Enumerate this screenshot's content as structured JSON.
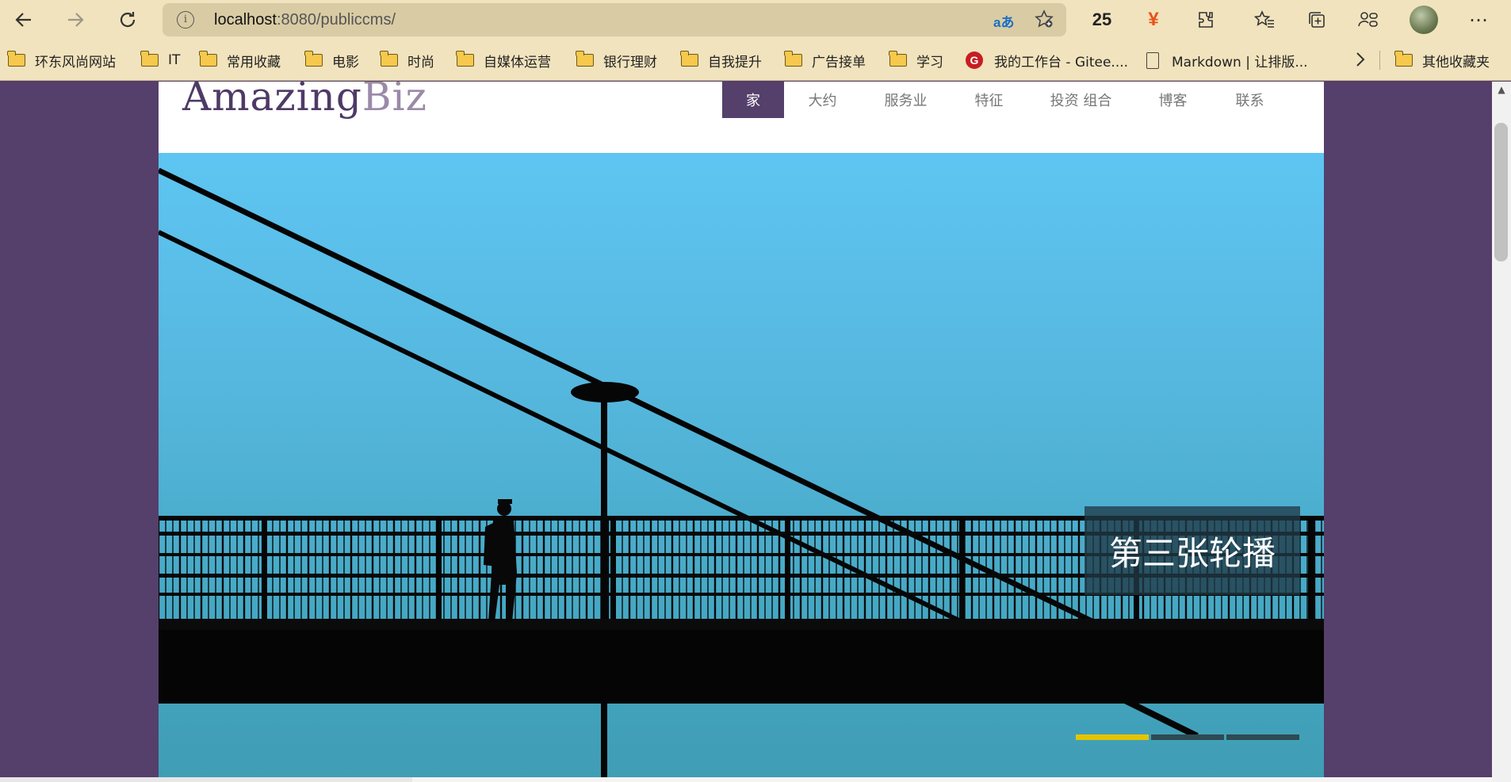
{
  "browser": {
    "url_host": "localhost",
    "url_rest": ":8080/publiccms/",
    "translate_glyph": "aあ",
    "count": "25",
    "yen": "¥"
  },
  "bookmarks": [
    {
      "label": "环东风尚网站",
      "icon": "folder-icon"
    },
    {
      "label": "IT",
      "icon": "folder-icon"
    },
    {
      "label": "常用收藏",
      "icon": "folder-icon"
    },
    {
      "label": "电影",
      "icon": "folder-icon"
    },
    {
      "label": "时尚",
      "icon": "folder-icon"
    },
    {
      "label": "自媒体运营",
      "icon": "folder-icon"
    },
    {
      "label": "银行理财",
      "icon": "folder-icon"
    },
    {
      "label": "自我提升",
      "icon": "folder-icon"
    },
    {
      "label": "广告接单",
      "icon": "folder-icon"
    },
    {
      "label": "学习",
      "icon": "folder-icon"
    },
    {
      "label": "我的工作台 - Gitee....",
      "icon": "gitee-icon"
    },
    {
      "label": "Markdown | 让排版...",
      "icon": "document-icon"
    }
  ],
  "other_bookmarks": "其他收藏夹",
  "site": {
    "logo_main": "Amazing",
    "logo_accent": "Biz",
    "nav": [
      "家",
      "大约",
      "服务业",
      "特征",
      "投资 组合",
      "博客",
      "联系"
    ],
    "active_nav": 0,
    "slider": {
      "caption": "第三张轮播",
      "slide_count": 3,
      "active_slide": 0
    }
  },
  "colors": {
    "brand_purple": "#553f6b",
    "accent_yellow": "#e5c400",
    "toolbar": "#f1e3bd"
  }
}
